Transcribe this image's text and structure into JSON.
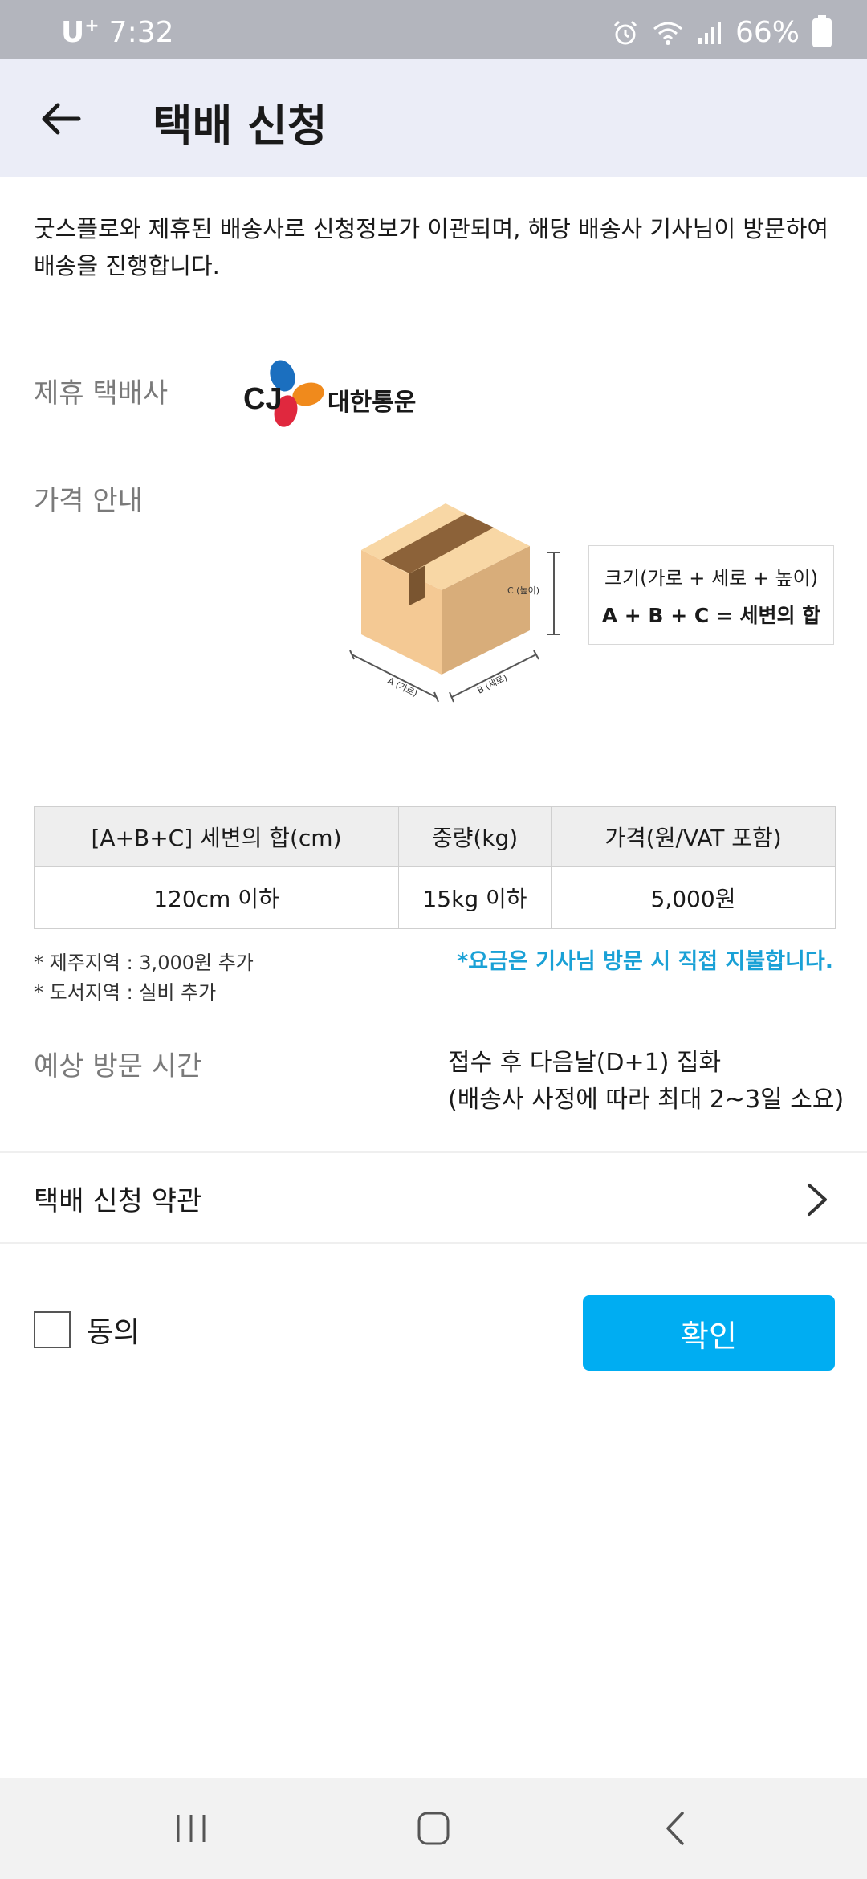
{
  "status_bar": {
    "carrier": "U",
    "carrier_sup": "+",
    "time": "7:32",
    "battery": "66%"
  },
  "header": {
    "title": "택배 신청"
  },
  "intro": {
    "text": "굿스플로와 제휴된 배송사로 신청정보가 이관되며, 해당 배송사 기사님이 방문하여 배송을 진행합니다."
  },
  "partner": {
    "label": "제휴 택배사",
    "logo_text": "CJ",
    "logo_kr": "대한통운"
  },
  "price_guide": {
    "label": "가격 안내",
    "dim_c": "C (높이)",
    "dim_a": "A (가로)",
    "dim_b": "B (세로)",
    "size_line1": "크기(가로 + 세로 + 높이)",
    "size_line2": "A + B + C = 세변의 합"
  },
  "price_table": {
    "headers": [
      "[A+B+C] 세변의 합(cm)",
      "중량(kg)",
      "가격(원/VAT 포함)"
    ],
    "rows": [
      [
        "120cm 이하",
        "15kg 이하",
        "5,000원"
      ]
    ]
  },
  "notes": {
    "jeju": "* 제주지역 : 3,000원 추가",
    "island": "* 도서지역 : 실비 추가",
    "payment": "*요금은 기사님 방문 시 직접 지불합니다."
  },
  "visit": {
    "label": "예상 방문 시간",
    "line1": "접수 후 다음날(D+1) 집화",
    "line2": "(배송사 사정에 따라 최대 2~3일 소요)"
  },
  "terms": {
    "label": "택배 신청 약관"
  },
  "agree": {
    "label": "동의",
    "checked": false
  },
  "confirm": {
    "label": "확인"
  },
  "colors": {
    "accent": "#00adf2",
    "price_blue": "#1aa1d6",
    "header_bg": "#ebedf7"
  }
}
